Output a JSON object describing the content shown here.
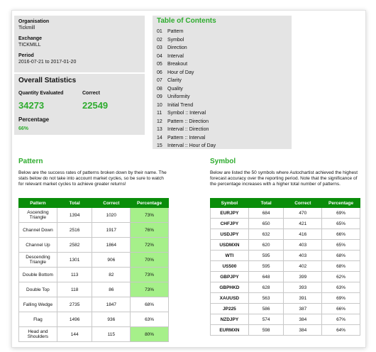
{
  "info": {
    "org_label": "Organisation",
    "org_value": "Tickmill",
    "exchange_label": "Exchange",
    "exchange_value": "TICKMILL",
    "period_label": "Period",
    "period_value": "2016-07-21 to 2017-01-20"
  },
  "stats": {
    "title": "Overall Statistics",
    "quantity_label": "Quantity Evaluated",
    "quantity_value": "34273",
    "correct_label": "Correct",
    "correct_value": "22549",
    "percentage_label": "Percentage",
    "percentage_value": "66%"
  },
  "toc": {
    "title": "Table of Contents",
    "items": [
      {
        "num": "01",
        "label": "Pattern"
      },
      {
        "num": "02",
        "label": "Symbol"
      },
      {
        "num": "03",
        "label": "Direction"
      },
      {
        "num": "04",
        "label": "Interval"
      },
      {
        "num": "05",
        "label": "Breakout"
      },
      {
        "num": "06",
        "label": "Hour of Day"
      },
      {
        "num": "07",
        "label": "Clarity"
      },
      {
        "num": "08",
        "label": "Quality"
      },
      {
        "num": "09",
        "label": "Uniformity"
      },
      {
        "num": "10",
        "label": "Initial Trend"
      },
      {
        "num": "11",
        "label": "Symbol :: Interval"
      },
      {
        "num": "12",
        "label": "Pattern :: Direction"
      },
      {
        "num": "13",
        "label": "Interval :: Direction"
      },
      {
        "num": "14",
        "label": "Pattern :: Interval"
      },
      {
        "num": "15",
        "label": "Interval :: Hour of Day"
      }
    ]
  },
  "pattern": {
    "title": "Pattern",
    "desc": "Below are the success rates of patterns broken down by their name. The stats below do not take into account market cycles, so be sure to watch for relevant market cycles to achieve greater returns!",
    "headers": [
      "Pattern",
      "Total",
      "Correct",
      "Percentage"
    ],
    "rows": [
      {
        "name": "Ascending Triangle",
        "total": "1394",
        "correct": "1020",
        "pct": "73%",
        "hi": true
      },
      {
        "name": "Channel Down",
        "total": "2516",
        "correct": "1917",
        "pct": "76%",
        "hi": true
      },
      {
        "name": "Channel Up",
        "total": "2582",
        "correct": "1864",
        "pct": "72%",
        "hi": true
      },
      {
        "name": "Descending Triangle",
        "total": "1301",
        "correct": "906",
        "pct": "70%",
        "hi": true
      },
      {
        "name": "Double Bottom",
        "total": "113",
        "correct": "82",
        "pct": "73%",
        "hi": true
      },
      {
        "name": "Double Top",
        "total": "118",
        "correct": "86",
        "pct": "73%",
        "hi": true
      },
      {
        "name": "Falling Wedge",
        "total": "2735",
        "correct": "1847",
        "pct": "68%",
        "hi": false
      },
      {
        "name": "Flag",
        "total": "1496",
        "correct": "936",
        "pct": "63%",
        "hi": false
      },
      {
        "name": "Head and Shoulders",
        "total": "144",
        "correct": "115",
        "pct": "80%",
        "hi": true
      }
    ]
  },
  "symbol": {
    "title": "Symbol",
    "desc": "Below are listed the 50 symbols where Autochartist achieved the highest forecast accuracy over the reporting period. Note that the significance of the percentage increases with a higher total number of patterns.",
    "headers": [
      "Symbol",
      "Total",
      "Correct",
      "Percentage"
    ],
    "rows": [
      {
        "name": "EURJPY",
        "total": "684",
        "correct": "470",
        "pct": "69%"
      },
      {
        "name": "CHFJPY",
        "total": "650",
        "correct": "421",
        "pct": "65%"
      },
      {
        "name": "USDJPY",
        "total": "632",
        "correct": "416",
        "pct": "66%"
      },
      {
        "name": "USDMXN",
        "total": "620",
        "correct": "403",
        "pct": "65%"
      },
      {
        "name": "WTI",
        "total": "595",
        "correct": "403",
        "pct": "68%"
      },
      {
        "name": "US500",
        "total": "595",
        "correct": "402",
        "pct": "68%"
      },
      {
        "name": "GBPJPY",
        "total": "648",
        "correct": "399",
        "pct": "62%"
      },
      {
        "name": "GBPHKD",
        "total": "628",
        "correct": "393",
        "pct": "63%"
      },
      {
        "name": "XAUUSD",
        "total": "563",
        "correct": "391",
        "pct": "69%"
      },
      {
        "name": "JP225",
        "total": "586",
        "correct": "387",
        "pct": "66%"
      },
      {
        "name": "NZDJPY",
        "total": "574",
        "correct": "384",
        "pct": "67%"
      },
      {
        "name": "EURMXN",
        "total": "598",
        "correct": "384",
        "pct": "64%"
      }
    ]
  }
}
